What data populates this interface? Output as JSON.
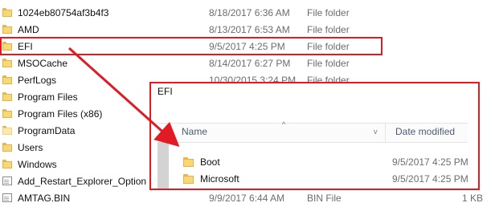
{
  "file_list": {
    "rows": [
      {
        "icon": "folder-icon",
        "name": "1024eb80754af3b4f3",
        "date": "8/18/2017 6:36 AM",
        "type": "File folder",
        "size": ""
      },
      {
        "icon": "folder-icon",
        "name": "AMD",
        "date": "8/13/2017 6:53 AM",
        "type": "File folder",
        "size": ""
      },
      {
        "icon": "folder-icon",
        "name": "EFI",
        "date": "9/5/2017 4:25 PM",
        "type": "File folder",
        "size": ""
      },
      {
        "icon": "folder-icon",
        "name": "MSOCache",
        "date": "8/14/2017 6:27 PM",
        "type": "File folder",
        "size": ""
      },
      {
        "icon": "folder-icon",
        "name": "PerfLogs",
        "date": "10/30/2015 3:24 PM",
        "type": "File folder",
        "size": ""
      },
      {
        "icon": "folder-icon",
        "name": "Program Files",
        "date": "",
        "type": "",
        "size": ""
      },
      {
        "icon": "folder-icon",
        "name": "Program Files (x86)",
        "date": "",
        "type": "",
        "size": ""
      },
      {
        "icon": "folder-icon-light",
        "name": "ProgramData",
        "date": "",
        "type": "",
        "size": ""
      },
      {
        "icon": "folder-icon",
        "name": "Users",
        "date": "",
        "type": "",
        "size": ""
      },
      {
        "icon": "folder-icon",
        "name": "Windows",
        "date": "",
        "type": "",
        "size": ""
      },
      {
        "icon": "file-icon",
        "name": "Add_Restart_Explorer_Option",
        "date": "",
        "type": "",
        "size": ""
      },
      {
        "icon": "file-icon",
        "name": "AMTAG.BIN",
        "date": "9/9/2017 6:44 AM",
        "type": "BIN File",
        "size": "1 KB"
      }
    ]
  },
  "zoom": {
    "title": "EFI",
    "header": {
      "name_label": "Name",
      "date_label": "Date modified",
      "sort_arrow": "^",
      "dropdown": "v"
    },
    "rows": [
      {
        "icon": "folder-icon",
        "name": "Boot",
        "date": "9/5/2017 4:25 PM"
      },
      {
        "icon": "folder-icon",
        "name": "Microsoft",
        "date": "9/5/2017 4:25 PM"
      }
    ]
  },
  "colors": {
    "annotation_red": "#e01b24",
    "folder_yellow": "#f8d775"
  }
}
